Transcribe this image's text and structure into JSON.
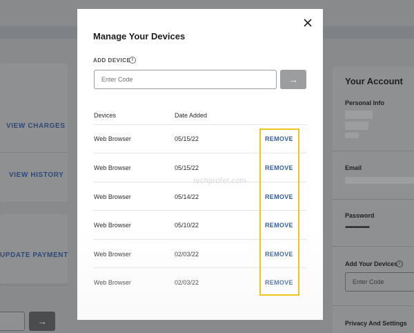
{
  "background": {
    "links": [
      "VIEW CHARGES",
      "VIEW HISTORY",
      "UPDATE PAYMENT"
    ],
    "account": {
      "title": "Your Account",
      "personal_info_label": "Personal Info",
      "email_label": "Email",
      "password_label": "Password",
      "password_value": "••••••••••••••",
      "add_devices_label": "Add Your Devices",
      "add_devices_placeholder": "Enter Code",
      "privacy_label": "Privacy And Settings"
    },
    "left_button_icon": "arrow-right-icon"
  },
  "modal": {
    "title": "Manage Your Devices",
    "close_icon": "close-icon",
    "add_device_label": "ADD DEVICE",
    "info_icon_glyph": "i",
    "code_placeholder": "Enter Code",
    "submit_icon": "arrow-right-icon",
    "columns": {
      "devices": "Devices",
      "date_added": "Date Added"
    },
    "devices": [
      {
        "name": "Web Browser",
        "date": "05/15/22",
        "action": "REMOVE"
      },
      {
        "name": "Web Browser",
        "date": "05/15/22",
        "action": "REMOVE"
      },
      {
        "name": "Web Browser",
        "date": "05/14/22",
        "action": "REMOVE"
      },
      {
        "name": "Web Browser",
        "date": "05/10/22",
        "action": "REMOVE"
      },
      {
        "name": "Web Browser",
        "date": "02/03/22",
        "action": "REMOVE"
      },
      {
        "name": "Web Browser",
        "date": "02/03/22",
        "action": "REMOVE"
      }
    ]
  },
  "overlay": {
    "watermark": "techprofet.com",
    "highlight_color": "#f2c318"
  },
  "colors": {
    "link_blue": "#2f5ea8",
    "backdrop": "#888a8c"
  }
}
